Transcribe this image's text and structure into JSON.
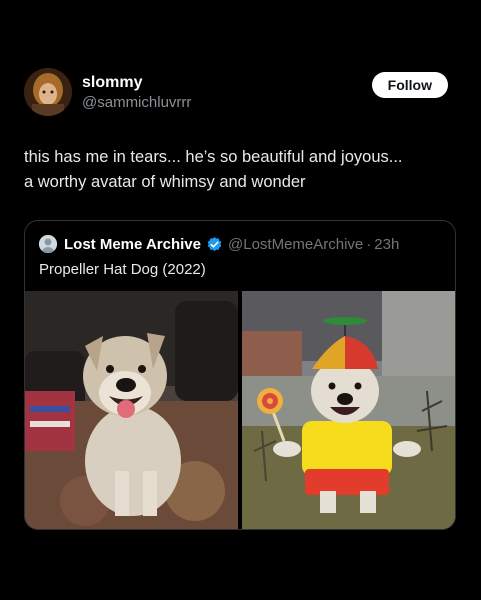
{
  "post": {
    "display_name": "slommy",
    "handle": "@sammichluvrrr",
    "follow_label": "Follow",
    "text_line1": "this has me in tears... he’s so beautiful and joyous...",
    "text_line2": "a worthy avatar of whimsy and wonder"
  },
  "quote": {
    "name": "Lost Meme Archive",
    "handle": "@LostMemeArchive",
    "separator": "·",
    "time": "23h",
    "text": "Propeller Hat Dog (2022)"
  },
  "colors": {
    "background": "#000000",
    "follow_bg": "#ffffff",
    "verified": "#1d9bf0",
    "border": "#2f3336"
  },
  "icons": {
    "verified": "verified-badge-icon",
    "quote_avatar": "default-avatar-icon"
  }
}
